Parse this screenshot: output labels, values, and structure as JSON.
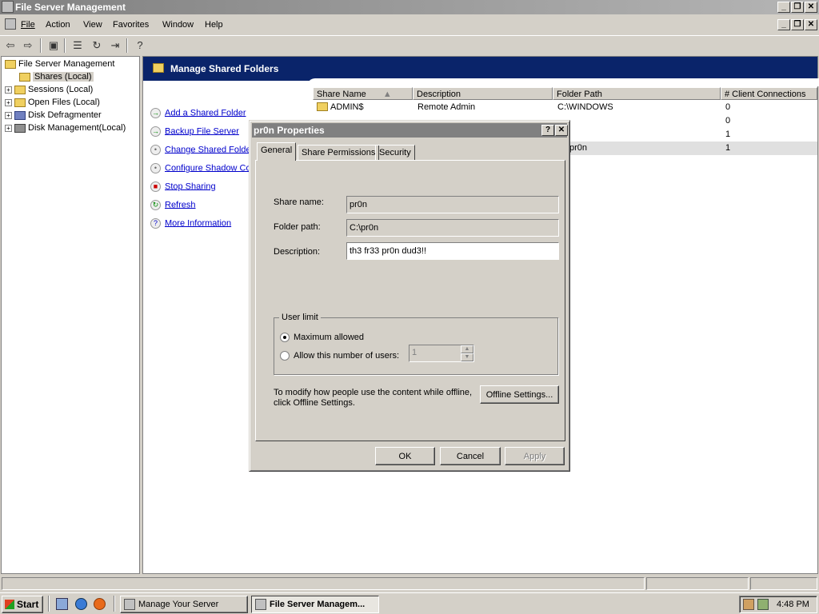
{
  "window": {
    "title": "File Server Management"
  },
  "menu": [
    "File",
    "Action",
    "View",
    "Favorites",
    "Window",
    "Help"
  ],
  "toolbar_icons": [
    "back-icon",
    "forward-icon",
    "up-folder-icon",
    "properties-icon",
    "refresh-icon",
    "export-icon",
    "help-icon"
  ],
  "tree": {
    "root": "File Server Management",
    "items": [
      "Shares (Local)",
      "Sessions (Local)",
      "Open Files (Local)",
      "Disk Defragmenter",
      "Disk Management(Local)"
    ]
  },
  "banner": {
    "title": "Manage Shared Folders"
  },
  "tasks": [
    "Add a Shared Folder",
    "Backup File Server",
    "Change Shared Folde",
    "Configure Shadow Co",
    "Stop Sharing",
    "Refresh",
    "More Information"
  ],
  "list": {
    "columns": [
      "Share Name",
      "Description",
      "Folder Path",
      "# Client Connections"
    ],
    "rows": [
      {
        "name": "ADMIN$",
        "description": "Remote Admin",
        "path": "C:\\WINDOWS",
        "connections": "0"
      },
      {
        "name": "",
        "description": "",
        "path": "",
        "connections": "0"
      },
      {
        "name": "",
        "description": "",
        "path": "",
        "connections": "1"
      },
      {
        "name": "",
        "description": "",
        "path": "pr0n",
        "connections": "1"
      }
    ]
  },
  "dialog": {
    "title": "pr0n Properties",
    "tabs": [
      "General",
      "Share Permissions",
      "Security"
    ],
    "share_name_label": "Share name:",
    "share_name": "pr0n",
    "folder_path_label": "Folder path:",
    "folder_path": "C:\\pr0n",
    "description_label": "Description:",
    "description": "th3 fr33 pr0n dud3!!",
    "user_limit_label": "User limit",
    "max_allowed": "Maximum allowed",
    "allow_number": "Allow this number of users:",
    "user_count": "1",
    "offline_text_1": "To modify how people use the content while offline,",
    "offline_text_2": "click Offline Settings.",
    "offline_button": "Offline Settings...",
    "ok": "OK",
    "cancel": "Cancel",
    "apply": "Apply"
  },
  "taskbar": {
    "start": "Start",
    "buttons": [
      "Manage Your Server",
      "File Server Managem..."
    ],
    "clock": "4:48 PM"
  }
}
